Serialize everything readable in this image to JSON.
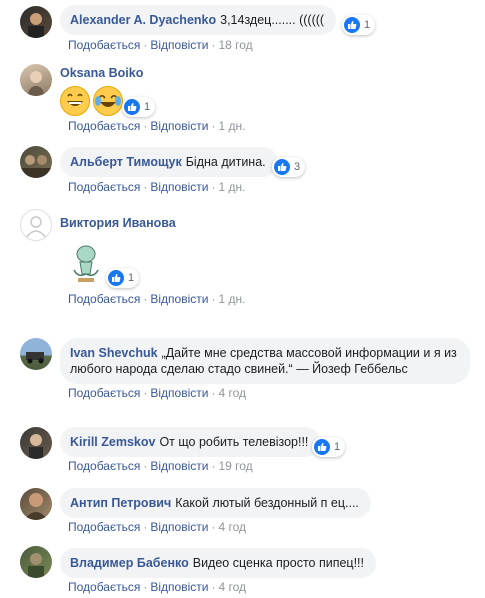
{
  "common": {
    "like_label": "Подобається",
    "reply_label": "Відповісти",
    "separator": "·",
    "like_color": "#1877f2",
    "author_color": "#385898"
  },
  "comments": [
    {
      "author": "Alexander A. Dyachenko",
      "text": "3,14здец....... ((((((",
      "reactions": "1",
      "time": "18 год"
    },
    {
      "author": "Oksana Boiko",
      "text": "",
      "reactions": "1",
      "time": "1 дн.",
      "media": [
        "grinning-face-icon",
        "tears-of-joy-icon"
      ]
    },
    {
      "author": "Альберт Тимощук",
      "text": "Бідна дитина.",
      "reactions": "3",
      "time": "1 дн."
    },
    {
      "author": "Виктория Иванова",
      "text": "",
      "reactions": "1",
      "time": "1 дн.",
      "media": [
        "squidward-sticker"
      ]
    },
    {
      "author": "Ivan Shevchuk",
      "text": "„Дайте мне средства массовой информации и я из любого народа сделаю стадо свиней.“ — Йозеф Геббельс",
      "reactions": "",
      "time": "4 год"
    },
    {
      "author": "Kirill Zemskov",
      "text": "От що робить телевізор!!!",
      "reactions": "1",
      "time": "19 год"
    },
    {
      "author": "Антип Петрович",
      "text": "Какой лютый бездонный п    ец....",
      "reactions": "",
      "time": "4 год"
    },
    {
      "author": "Владимер Бабенко",
      "text": "Видео сценка просто пипец!!!",
      "reactions": "",
      "time": "4 год"
    }
  ]
}
